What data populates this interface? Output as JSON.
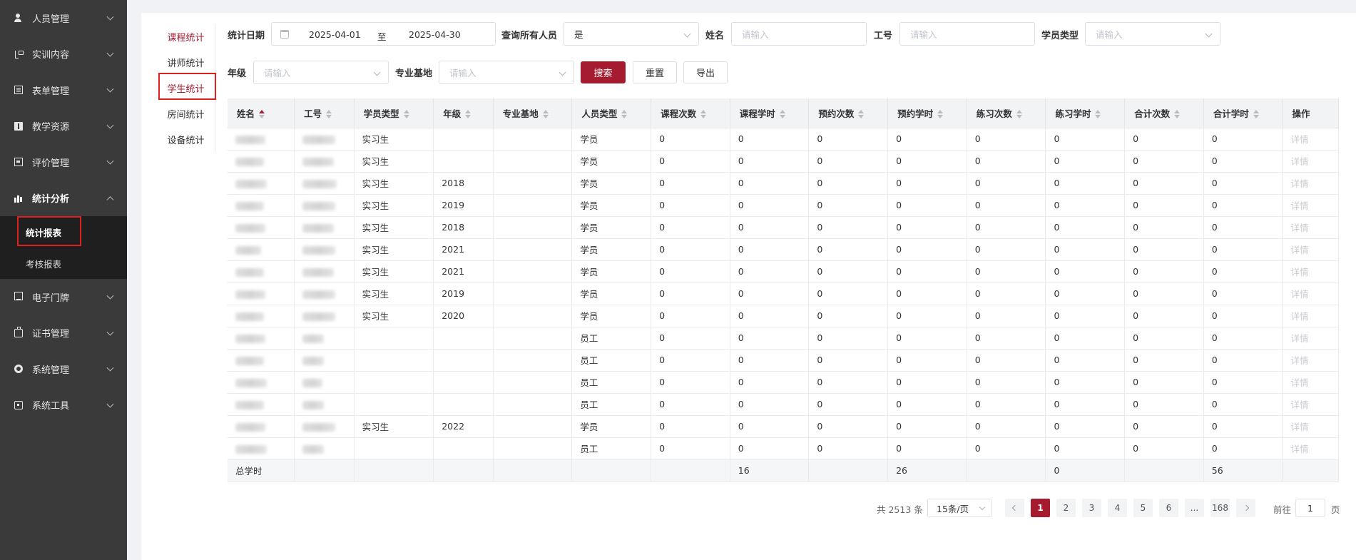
{
  "sidebar": {
    "items": [
      {
        "label": "人员管理",
        "icon": "user-icon"
      },
      {
        "label": "实训内容",
        "icon": "tree-icon"
      },
      {
        "label": "表单管理",
        "icon": "form-icon"
      },
      {
        "label": "教学资源",
        "icon": "document-icon"
      },
      {
        "label": "评价管理",
        "icon": "evaluation-icon"
      },
      {
        "label": "统计分析",
        "icon": "bar-chart-icon"
      },
      {
        "label": "电子门牌",
        "icon": "screen-icon"
      },
      {
        "label": "证书管理",
        "icon": "certificate-icon"
      },
      {
        "label": "系统管理",
        "icon": "gear-icon"
      },
      {
        "label": "系统工具",
        "icon": "toolbox-icon"
      }
    ],
    "submenu": [
      {
        "label": "统计报表"
      },
      {
        "label": "考核报表"
      }
    ]
  },
  "stat_nav": {
    "items": [
      {
        "label": "课程统计"
      },
      {
        "label": "讲师统计"
      },
      {
        "label": "学生统计"
      },
      {
        "label": "房间统计"
      },
      {
        "label": "设备统计"
      }
    ]
  },
  "filters": {
    "date_label": "统计日期",
    "date_start": "2025-04-01",
    "date_sep": "至",
    "date_end": "2025-04-30",
    "all_people_label": "查询所有人员",
    "all_people_value": "是",
    "name_label": "姓名",
    "name_placeholder": "请输入",
    "job_no_label": "工号",
    "job_no_placeholder": "请输入",
    "student_type_label": "学员类型",
    "student_type_placeholder": "请输入",
    "grade_label": "年级",
    "grade_placeholder": "请输入",
    "base_label": "专业基地",
    "base_placeholder": "请输入",
    "search_btn": "搜索",
    "reset_btn": "重置",
    "export_btn": "导出"
  },
  "table": {
    "headers": [
      "姓名",
      "工号",
      "学员类型",
      "年级",
      "专业基地",
      "人员类型",
      "课程次数",
      "课程学时",
      "预约次数",
      "预约学时",
      "练习次数",
      "练习学时",
      "合计次数",
      "合计学时",
      "操作"
    ],
    "rows": [
      [
        "",
        "",
        "实习生",
        "",
        "",
        "学员",
        "0",
        "0",
        "0",
        "0",
        "0",
        "0",
        "0",
        "0",
        "详情"
      ],
      [
        "",
        "",
        "实习生",
        "",
        "",
        "学员",
        "0",
        "0",
        "0",
        "0",
        "0",
        "0",
        "0",
        "0",
        "详情"
      ],
      [
        "",
        "",
        "实习生",
        "2018",
        "",
        "学员",
        "0",
        "0",
        "0",
        "0",
        "0",
        "0",
        "0",
        "0",
        "详情"
      ],
      [
        "",
        "",
        "实习生",
        "2019",
        "",
        "学员",
        "0",
        "0",
        "0",
        "0",
        "0",
        "0",
        "0",
        "0",
        "详情"
      ],
      [
        "",
        "",
        "实习生",
        "2018",
        "",
        "学员",
        "0",
        "0",
        "0",
        "0",
        "0",
        "0",
        "0",
        "0",
        "详情"
      ],
      [
        "",
        "",
        "实习生",
        "2021",
        "",
        "学员",
        "0",
        "0",
        "0",
        "0",
        "0",
        "0",
        "0",
        "0",
        "详情"
      ],
      [
        "",
        "",
        "实习生",
        "2021",
        "",
        "学员",
        "0",
        "0",
        "0",
        "0",
        "0",
        "0",
        "0",
        "0",
        "详情"
      ],
      [
        "",
        "",
        "实习生",
        "2019",
        "",
        "学员",
        "0",
        "0",
        "0",
        "0",
        "0",
        "0",
        "0",
        "0",
        "详情"
      ],
      [
        "",
        "",
        "实习生",
        "2020",
        "",
        "学员",
        "0",
        "0",
        "0",
        "0",
        "0",
        "0",
        "0",
        "0",
        "详情"
      ],
      [
        "",
        "",
        "",
        "",
        "",
        "员工",
        "0",
        "0",
        "0",
        "0",
        "0",
        "0",
        "0",
        "0",
        "详情"
      ],
      [
        "",
        "",
        "",
        "",
        "",
        "员工",
        "0",
        "0",
        "0",
        "0",
        "0",
        "0",
        "0",
        "0",
        "详情"
      ],
      [
        "",
        "",
        "",
        "",
        "",
        "员工",
        "0",
        "0",
        "0",
        "0",
        "0",
        "0",
        "0",
        "0",
        "详情"
      ],
      [
        "",
        "",
        "",
        "",
        "",
        "员工",
        "0",
        "0",
        "0",
        "0",
        "0",
        "0",
        "0",
        "0",
        "详情"
      ],
      [
        "",
        "",
        "实习生",
        "2022",
        "",
        "学员",
        "0",
        "0",
        "0",
        "0",
        "0",
        "0",
        "0",
        "0",
        "详情"
      ],
      [
        "",
        "",
        "",
        "",
        "",
        "员工",
        "0",
        "0",
        "0",
        "0",
        "0",
        "0",
        "0",
        "0",
        "详情"
      ]
    ],
    "total_row": [
      "总学时",
      "",
      "",
      "",
      "",
      "",
      "",
      "16",
      "",
      "26",
      "",
      "0",
      "",
      "56",
      ""
    ]
  },
  "pagination": {
    "total_text": "共 2513 条",
    "page_size": "15条/页",
    "pages": [
      "1",
      "2",
      "3",
      "4",
      "5",
      "6",
      "...",
      "168"
    ],
    "current_page": "1",
    "goto_label": "前往",
    "goto_value": "1",
    "goto_suffix": "页"
  },
  "colors": {
    "brand": "#a51c30",
    "sidebar_bg": "#3a3a3a",
    "submenu_bg": "#1f1f1f",
    "highlight_box": "#e02020"
  }
}
